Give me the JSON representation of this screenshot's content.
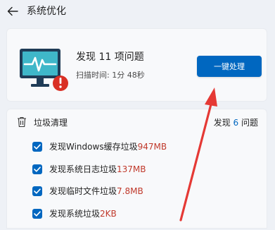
{
  "header": {
    "title": "系统优化",
    "back_icon": "arrow-left-icon"
  },
  "scan": {
    "result_prefix": "发现 ",
    "result_count": "11",
    "result_suffix": " 项问题",
    "scan_time_label": "扫描时间: ",
    "scan_time_value": "1分 48秒",
    "fix_button_label": "一键处理",
    "accent_color": "#0067c0",
    "icon": "monitor-alert-icon"
  },
  "junk": {
    "title": "垃圾清理",
    "summary_prefix": "发现 ",
    "summary_count": "6",
    "summary_suffix": " 问题",
    "icon": "trash-icon",
    "items": [
      {
        "label": "发现Windows缓存垃圾",
        "size": "947MB",
        "checked": true
      },
      {
        "label": "发现系统日志垃圾",
        "size": "137MB",
        "checked": true
      },
      {
        "label": "发现临时文件垃圾",
        "size": "7.8MB",
        "checked": true
      },
      {
        "label": "发现系统垃圾",
        "size": "2KB",
        "checked": true
      }
    ]
  },
  "annotation": {
    "type": "red-arrow",
    "color": "#e53935"
  }
}
